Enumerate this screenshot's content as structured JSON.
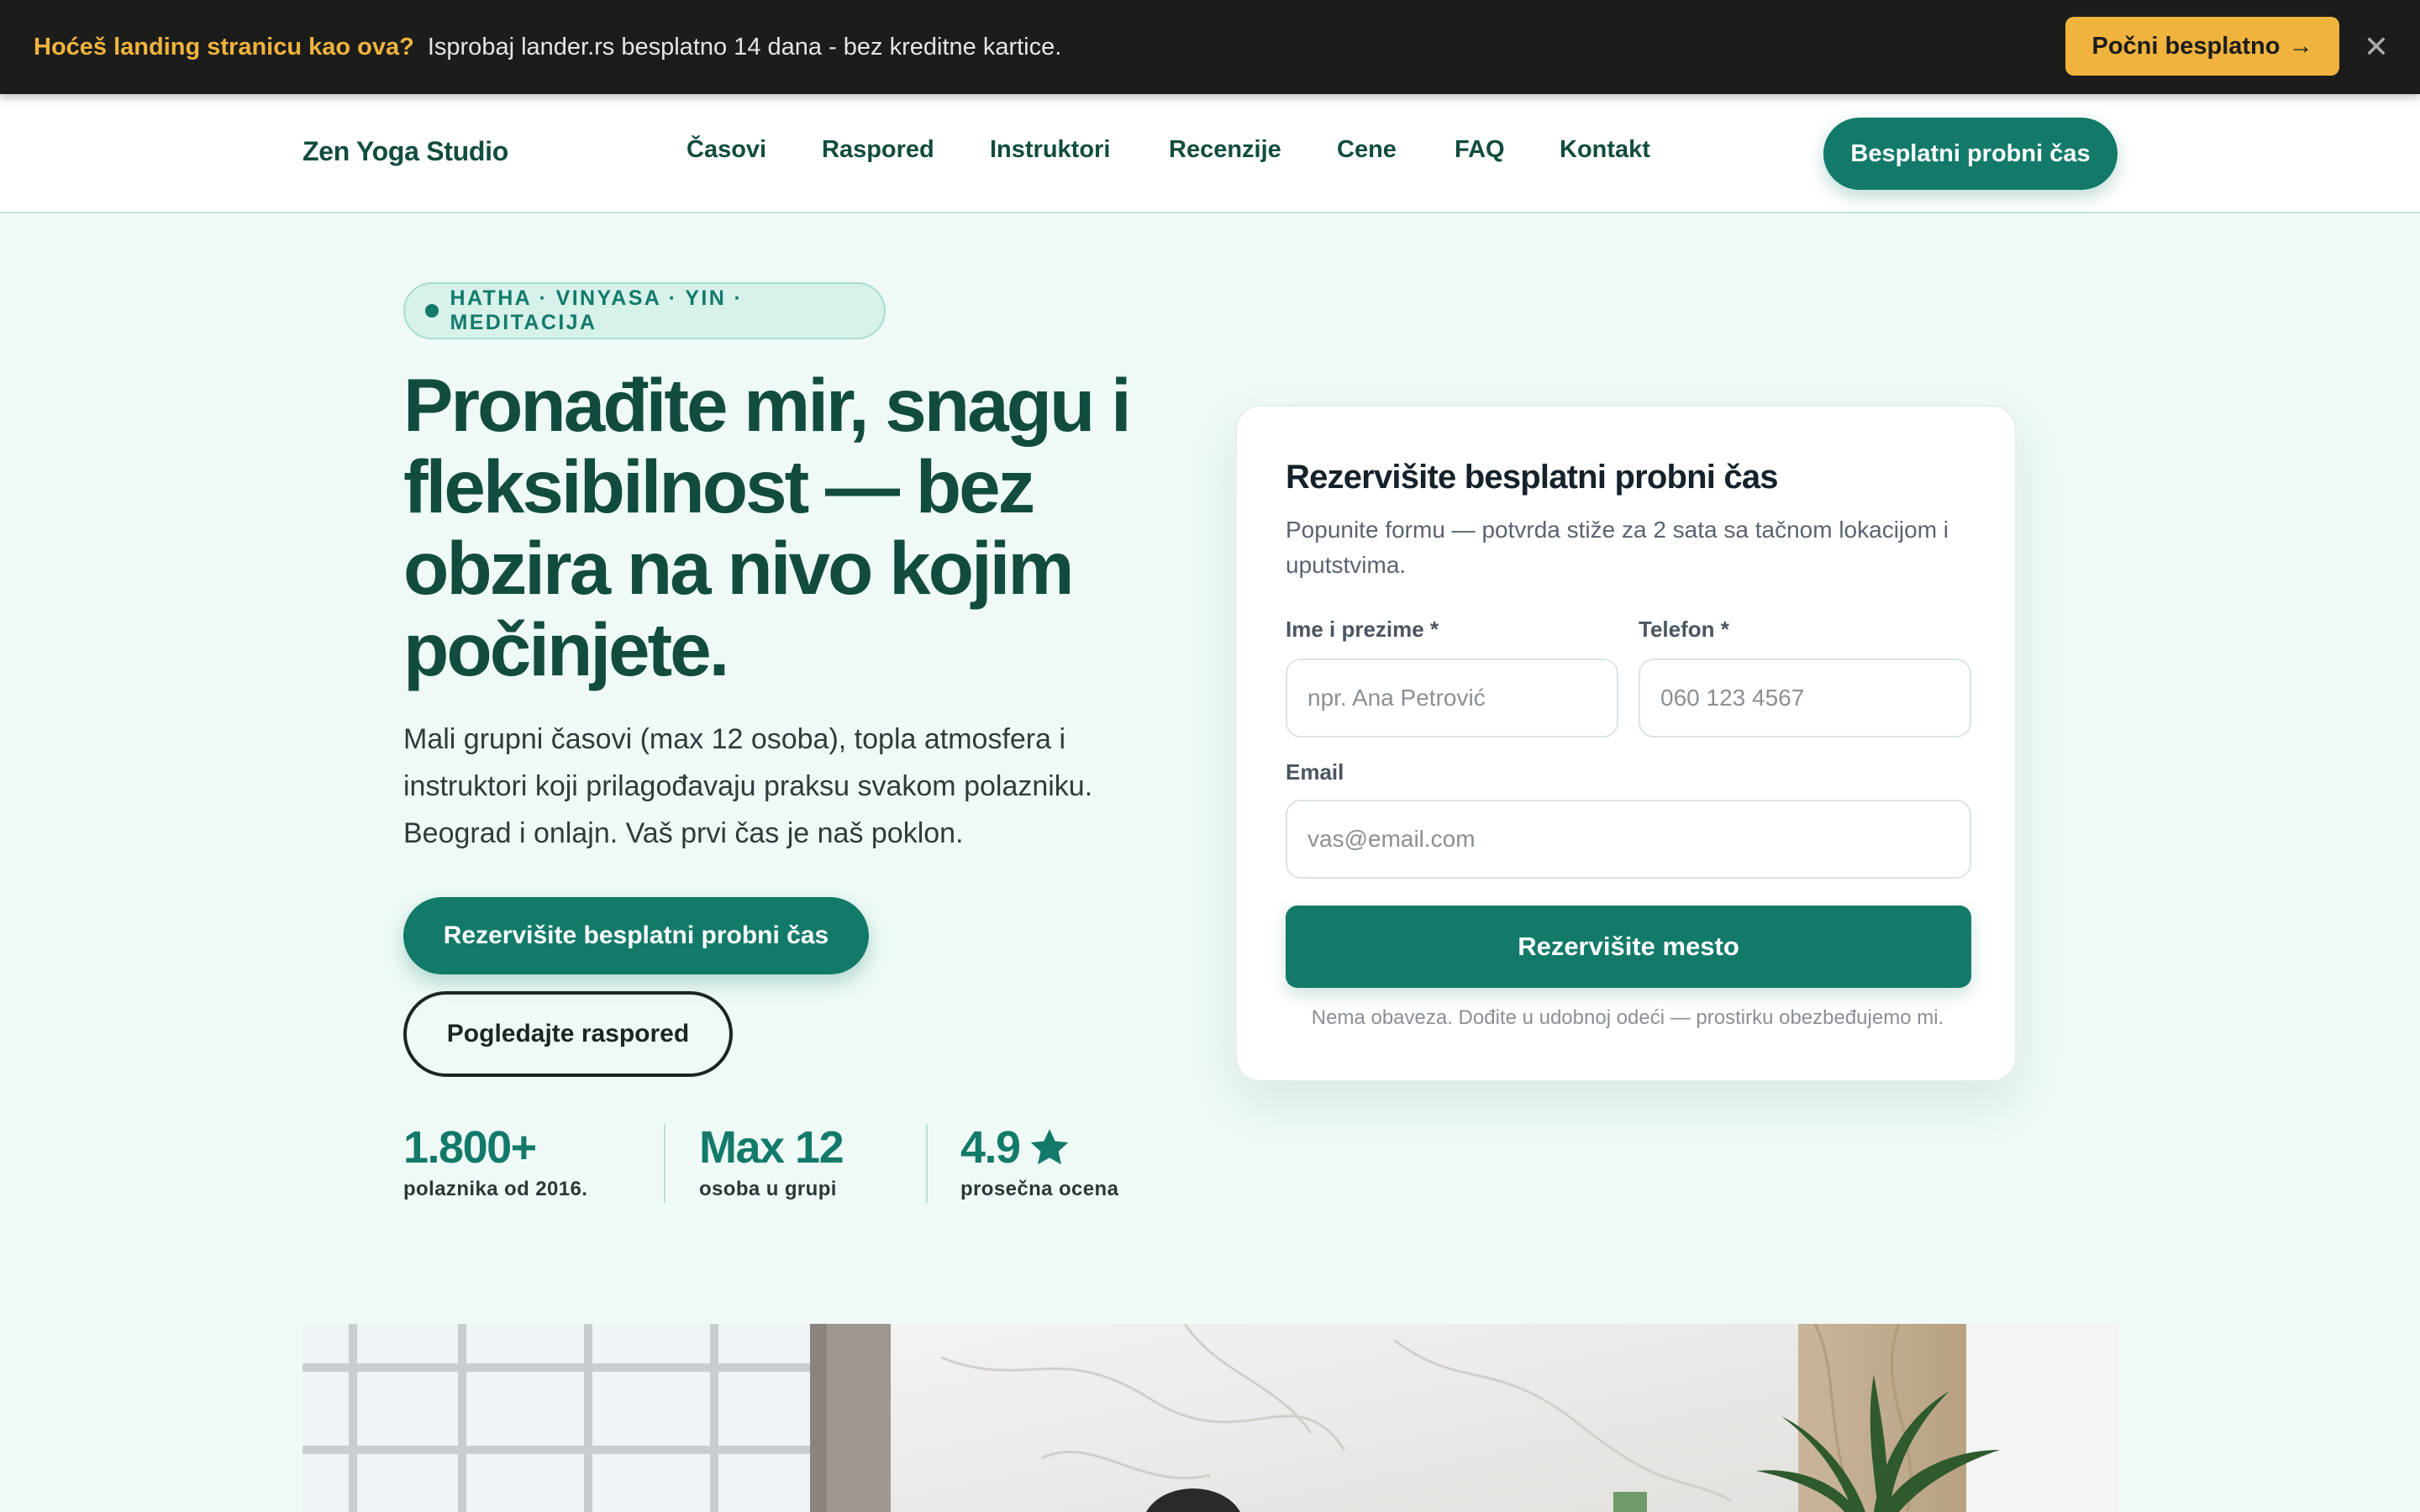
{
  "promo": {
    "title": "Hoćeš landing stranicu kao ova?",
    "text": "Isprobaj lander.rs besplatno 14 dana - bez kreditne kartice.",
    "cta_label": "Počni besplatno",
    "cta_arrow": "→",
    "close_glyph": "✕",
    "accent": "#f0b33e"
  },
  "header": {
    "logo": "Zen Yoga Studio",
    "nav": [
      "Časovi",
      "Raspored",
      "Instruktori",
      "Recenzije",
      "Cene",
      "FAQ",
      "Kontakt"
    ],
    "cta_label": "Besplatni probni čas"
  },
  "hero": {
    "badge": "HATHA · VINYASA · YIN · MEDITACIJA",
    "title": "Pronađite mir, snagu i fleksibilnost — bez obzira na nivo kojim počinjete.",
    "subtitle": "Mali grupni časovi (max 12 osoba), topla atmosfera i instruktori koji prilagođavaju praksu svakom polazniku. Beograd i onlajn. Vaš prvi čas je naš poklon.",
    "primary_label": "Rezervišite besplatni probni čas",
    "secondary_label": "Pogledajte raspored",
    "stats": [
      {
        "value": "1.800+",
        "label": "polaznika od 2016."
      },
      {
        "value": "Max 12",
        "label": "osoba u grupi"
      },
      {
        "value": "4.9",
        "label": "prosečna ocena",
        "icon": "star-icon"
      }
    ]
  },
  "form": {
    "title": "Rezervišite besplatni probni čas",
    "subtitle": "Popunite formu — potvrda stiže za 2 sata sa tačnom lokacijom i uputstvima.",
    "name_label": "Ime i prezime *",
    "name_placeholder": "npr. Ana Petrović",
    "phone_label": "Telefon *",
    "phone_placeholder": "060 123 4567",
    "email_label": "Email",
    "email_placeholder": "vas@email.com",
    "submit_label": "Rezervišite mesto",
    "note": "Nema obaveza. Dođite u udobnoj odeći — prostirku obezbeđujemo mi."
  },
  "colors": {
    "brand": "#137a6a",
    "brand_dark": "#114c3f",
    "background": "#effaf7"
  }
}
